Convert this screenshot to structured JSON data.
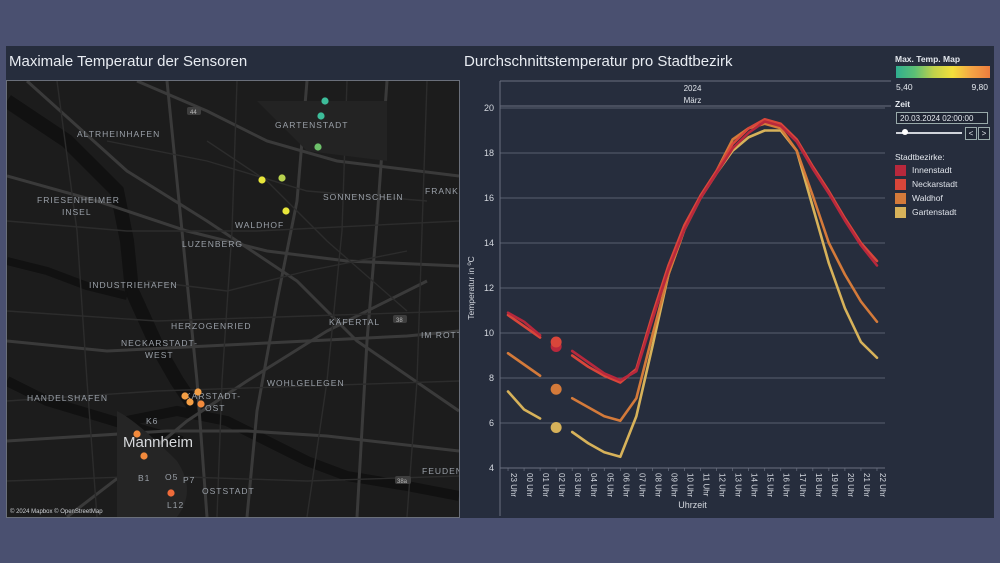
{
  "map_panel": {
    "title": "Maximale Temperatur der Sensoren",
    "attribution": "© 2024 Mapbox © OpenStreetMap",
    "city_label": "Mannheim",
    "district_labels": [
      "ALTRHEINHAFEN",
      "GARTENSTADT",
      "FRIESENHEIMER",
      "INSEL",
      "SONNENSCHEIN",
      "FRANK",
      "WALDHOF",
      "LUZENBERG",
      "INDUSTRIEHAFEN",
      "HERZOGENRIED",
      "KÄFERTAL",
      "IM ROTT",
      "NECKARSTADT-",
      "WEST",
      "HANDELSHAFEN",
      "WOHLGELEGEN",
      "KARSTADT-",
      "OST",
      "OSTSTADT",
      "FEUDEN",
      "K6",
      "B1",
      "O5",
      "P7",
      "L12"
    ],
    "road_labels": [
      "44",
      "38",
      "38a"
    ],
    "sensors": [
      {
        "temp": 5.6,
        "color": "#3dbd9a"
      },
      {
        "temp": 5.7,
        "color": "#3dbd9a"
      },
      {
        "temp": 6.4,
        "color": "#6dc06a"
      },
      {
        "temp": 8.1,
        "color": "#e8e63a"
      },
      {
        "temp": 7.4,
        "color": "#b8d24e"
      },
      {
        "temp": 8.1,
        "color": "#e8e63a"
      },
      {
        "temp": 9.0,
        "color": "#f49f45"
      },
      {
        "temp": 9.0,
        "color": "#f49f45"
      },
      {
        "temp": 9.1,
        "color": "#f49f45"
      },
      {
        "temp": 9.2,
        "color": "#f28a3c"
      },
      {
        "temp": 9.2,
        "color": "#f28a3c"
      },
      {
        "temp": 9.3,
        "color": "#f28a3c"
      },
      {
        "temp": 9.8,
        "color": "#ef6b3a"
      }
    ]
  },
  "sidebar": {
    "color_legend_title": "Max. Temp. Map",
    "color_min": "5,40",
    "color_max": "9,80",
    "time_title": "Zeit",
    "time_value": "20.03.2024 02:00:00",
    "prev_label": "<",
    "next_label": ">",
    "districts_title": "Stadtbezirke:",
    "districts": [
      {
        "name": "Innenstadt",
        "color": "#b8283c"
      },
      {
        "name": "Neckarstadt",
        "color": "#d9463a"
      },
      {
        "name": "Waldhof",
        "color": "#d47a3a"
      },
      {
        "name": "Gartenstadt",
        "color": "#d7b25a"
      }
    ]
  },
  "chart_panel": {
    "title": "Durchschnittstemperatur pro Stadtbezirk"
  },
  "chart_data": {
    "type": "line",
    "title": "Durchschnittstemperatur pro Stadtbezirk",
    "header_year": "2024",
    "header_month": "März",
    "xlabel": "Uhrzeit",
    "ylabel": "Temperatur in ºC",
    "ylim": [
      4,
      20
    ],
    "yticks": [
      4,
      6,
      8,
      10,
      12,
      14,
      16,
      18,
      20
    ],
    "x": [
      "23 Uhr",
      "00 Uhr",
      "01 Uhr",
      "02 Uhr",
      "03 Uhr",
      "04 Uhr",
      "05 Uhr",
      "06 Uhr",
      "07 Uhr",
      "08 Uhr",
      "09 Uhr",
      "10 Uhr",
      "11 Uhr",
      "12 Uhr",
      "13 Uhr",
      "14 Uhr",
      "15 Uhr",
      "16 Uhr",
      "17 Uhr",
      "18 Uhr",
      "19 Uhr",
      "20 Uhr",
      "21 Uhr",
      "22 Uhr"
    ],
    "highlight_index": 3,
    "series": [
      {
        "name": "Innenstadt",
        "color": "#b8283c",
        "values": [
          10.9,
          10.5,
          9.9,
          null,
          9.2,
          8.7,
          8.2,
          7.9,
          8.3,
          10.6,
          12.8,
          14.6,
          16.0,
          17.1,
          18.2,
          18.9,
          19.4,
          19.2,
          18.5,
          17.3,
          16.2,
          15.0,
          13.9,
          13.0
        ]
      },
      {
        "name": "Neckarstadt",
        "color": "#d9463a",
        "values": [
          10.8,
          10.3,
          9.8,
          null,
          9.0,
          8.5,
          8.1,
          7.8,
          8.4,
          10.8,
          13.0,
          14.8,
          16.1,
          17.2,
          18.4,
          19.1,
          19.5,
          19.3,
          18.6,
          17.4,
          16.3,
          15.1,
          14.0,
          13.2
        ]
      },
      {
        "name": "Waldhof",
        "color": "#d47a3a",
        "values": [
          9.1,
          8.6,
          8.1,
          null,
          7.1,
          6.7,
          6.3,
          6.1,
          7.1,
          9.9,
          12.6,
          14.6,
          16.1,
          17.2,
          18.6,
          19.1,
          19.3,
          19.1,
          18.1,
          16.1,
          14.0,
          12.6,
          11.4,
          10.5
        ]
      },
      {
        "name": "Gartenstadt",
        "color": "#d7b25a",
        "values": [
          7.4,
          6.6,
          6.2,
          null,
          5.6,
          5.1,
          4.7,
          4.5,
          6.3,
          9.4,
          12.6,
          14.6,
          16.0,
          17.1,
          18.1,
          18.7,
          19.0,
          19.0,
          18.1,
          15.6,
          13.1,
          11.1,
          9.6,
          8.9
        ]
      }
    ],
    "markers": [
      {
        "series": "Innenstadt",
        "x": "02 Uhr",
        "y": 9.4
      },
      {
        "series": "Neckarstadt",
        "x": "02 Uhr",
        "y": 9.6
      },
      {
        "series": "Waldhof",
        "x": "02 Uhr",
        "y": 7.5
      },
      {
        "series": "Gartenstadt",
        "x": "02 Uhr",
        "y": 5.8
      }
    ]
  }
}
